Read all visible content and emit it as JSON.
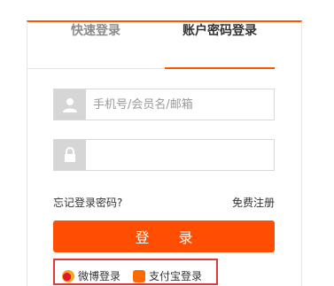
{
  "tabs": {
    "quick_login": "快速登录",
    "account_login": "账户密码登录"
  },
  "username": {
    "placeholder": "手机号/会员名/邮箱",
    "value": ""
  },
  "password": {
    "placeholder": "",
    "value": ""
  },
  "links": {
    "forgot_password": "忘记登录密码?",
    "register": "免费注册"
  },
  "login_button": "登 录",
  "third_party": {
    "weibo": "微博登录",
    "taobao": "支付宝登录"
  },
  "colors": {
    "accent": "#ff5500",
    "button": "#ff4d01",
    "highlight_box": "#e23a3a"
  },
  "icons": [
    "user-icon",
    "lock-icon",
    "weibo-icon",
    "alipay-icon"
  ]
}
